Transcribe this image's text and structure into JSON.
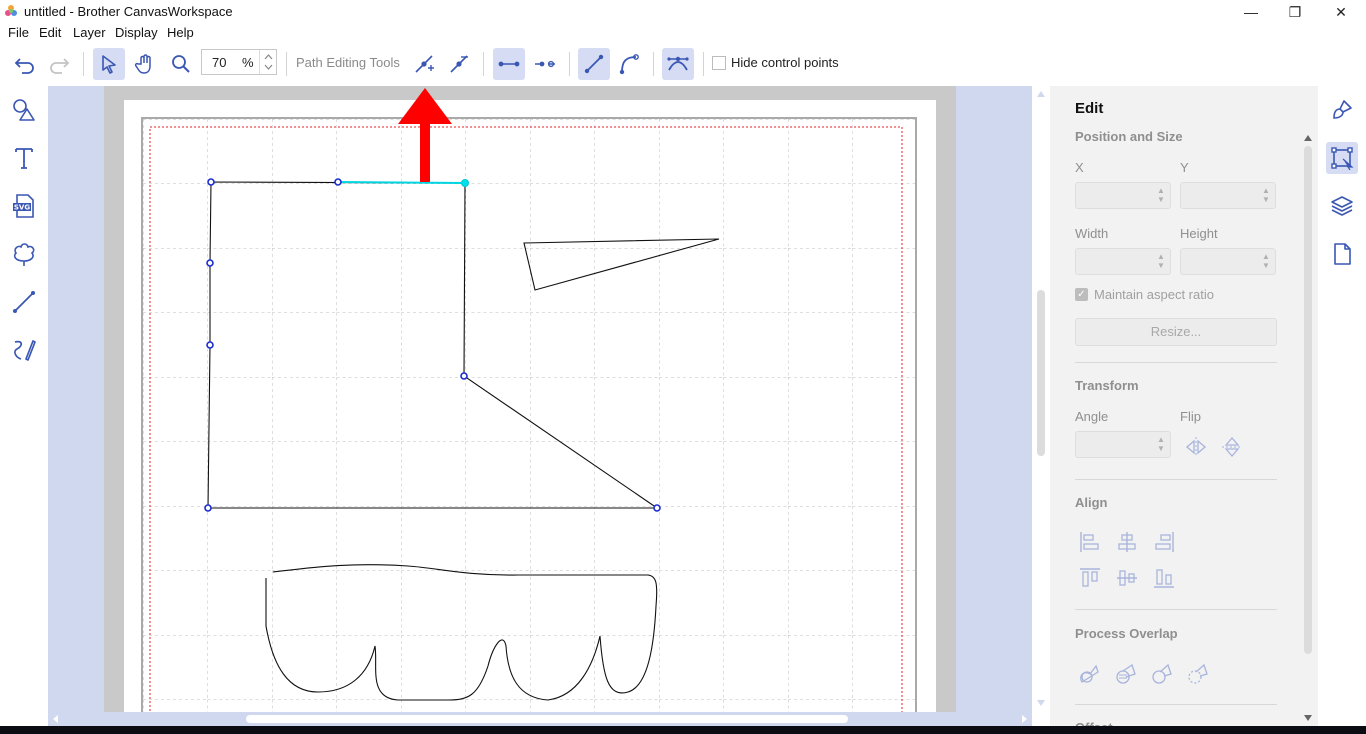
{
  "window": {
    "title": "untitled - Brother CanvasWorkspace",
    "minimize_glyph": "—",
    "restore_glyph": "❐",
    "close_glyph": "✕"
  },
  "menu": [
    "File",
    "Edit",
    "Layer",
    "Display",
    "Help"
  ],
  "toolbar": {
    "zoom_value": "70",
    "zoom_unit": "%",
    "path_tools_label": "Path Editing Tools",
    "hide_control_points_label": "Hide control points",
    "hide_control_points_checked": false,
    "icons": [
      "undo-icon",
      "redo-icon",
      "select-icon",
      "hand-icon",
      "zoom-icon",
      "add-node-icon",
      "delete-node-icon",
      "join-node-icon",
      "break-node-icon",
      "straight-segment-icon",
      "curve-segment-icon",
      "smooth-node-icon"
    ]
  },
  "left_tools": [
    "shapes-icon",
    "text-icon",
    "svg-icon",
    "pattern-icon",
    "line-icon",
    "freehand-icon"
  ],
  "left_tools_svg_text": "SVG",
  "panel": {
    "title": "Edit",
    "position_size": "Position and Size",
    "x_label": "X",
    "y_label": "Y",
    "width_label": "Width",
    "height_label": "Height",
    "maintain_aspect": "Maintain aspect ratio",
    "resize_button": "Resize...",
    "transform": "Transform",
    "angle_label": "Angle",
    "flip_label": "Flip",
    "align": "Align",
    "process_overlap": "Process Overlap",
    "offset": "Offset"
  },
  "right_tabs": [
    "brush-icon",
    "edit-transform-icon",
    "layers-icon",
    "page-icon"
  ],
  "colors": {
    "accent": "#3a57b4",
    "canvas_bg": "#d0d8ef",
    "highlight_segment": "#00d5e0",
    "annotation_arrow": "#ff0000",
    "margin_line": "#e02020"
  }
}
